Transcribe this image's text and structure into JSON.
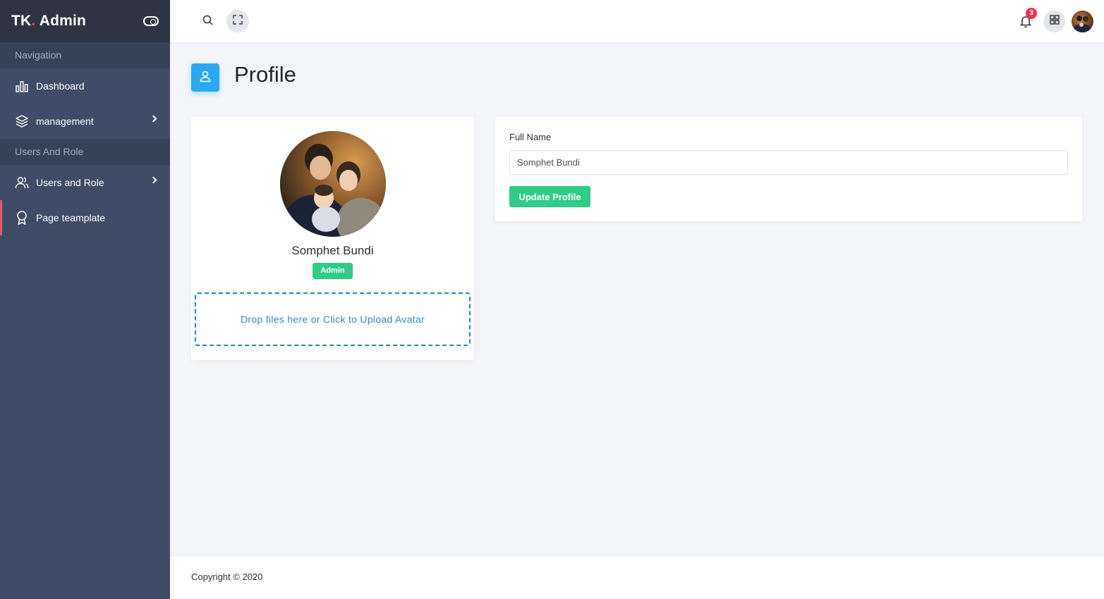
{
  "brand": {
    "name": "TK",
    "dot": ".",
    "suffix": " Admin"
  },
  "sidebar": {
    "sections": [
      {
        "label": "Navigation"
      },
      {
        "label": "Users And Role"
      }
    ],
    "items": [
      {
        "label": "Dashboard",
        "icon": "bar-chart-icon"
      },
      {
        "label": "management",
        "icon": "layers-icon"
      },
      {
        "label": "Users and Role",
        "icon": "users-icon"
      },
      {
        "label": "Page teamplate",
        "icon": "award-icon"
      }
    ]
  },
  "header": {
    "notification_count": "3",
    "icons": [
      "search-icon",
      "fullscreen-icon",
      "bell-icon",
      "apps-icon"
    ]
  },
  "page": {
    "title": "Profile",
    "icon": "user-icon"
  },
  "profile": {
    "name": "Somphet Bundi",
    "role": "Admin",
    "dropzone_text": "Drop files here or Click to Upload Avatar"
  },
  "form": {
    "full_name_label": "Full Name",
    "full_name_value": "Somphet Bundi",
    "update_button": "Update Profile"
  },
  "footer": {
    "copyright": "Copyright © 2020"
  },
  "colors": {
    "sidebar_bg": "#3f4c65",
    "brand_bg": "#2e3443",
    "accent_blue": "#2aa8f1",
    "success_green": "#2ecc86",
    "badge_red": "#e8344f",
    "active_marker": "#e85a6d"
  }
}
